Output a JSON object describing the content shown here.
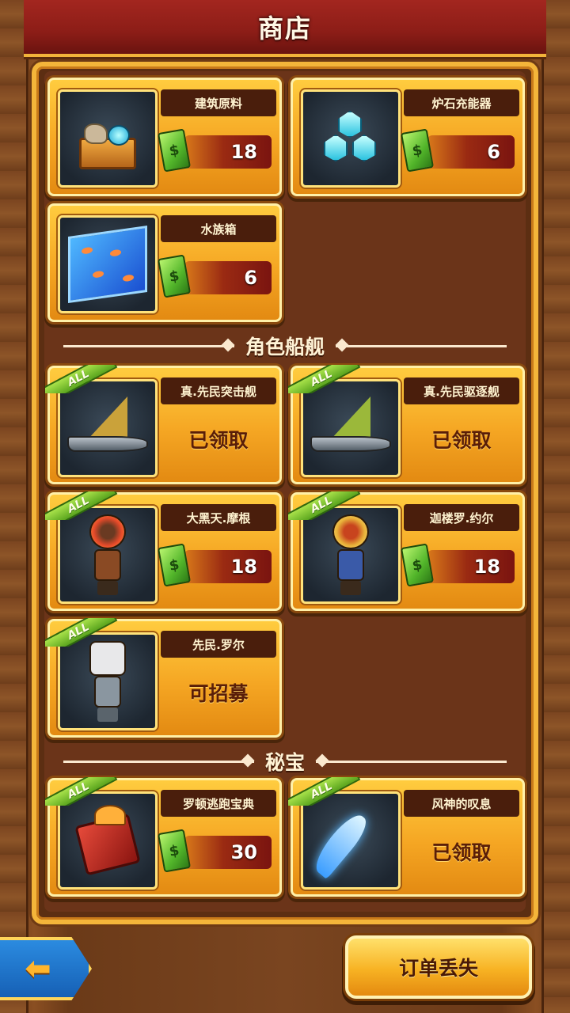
{
  "header": {
    "title": "商店"
  },
  "resources": [
    {
      "name": "建筑原料",
      "price": "18",
      "icon": "crate-of-stones-icon"
    },
    {
      "name": "炉石充能器",
      "price": "6",
      "icon": "blue-crystal-icon"
    },
    {
      "name": "水族箱",
      "price": "6",
      "icon": "aquarium-icon"
    }
  ],
  "ships_section": {
    "title": "角色船舰",
    "ships": [
      {
        "name": "真.先民突击舰",
        "status": "已领取",
        "badge": "ALL",
        "icon": "gold-sail-ship-icon"
      },
      {
        "name": "真.先民驱逐舰",
        "status": "已领取",
        "badge": "ALL",
        "icon": "green-sail-ship-icon"
      }
    ],
    "heroes": [
      {
        "name": "大黑天.摩根",
        "price": "18",
        "badge": "ALL",
        "icon": "fire-hair-warrior-icon"
      },
      {
        "name": "迦楼罗.约尔",
        "price": "18",
        "badge": "ALL",
        "icon": "golden-helmet-warrior-icon"
      },
      {
        "name": "先民.罗尔",
        "status": "可招募",
        "badge": "ALL",
        "icon": "robot-head-hero-icon"
      }
    ]
  },
  "treasure_section": {
    "title": "秘宝",
    "items": [
      {
        "name": "罗顿逃跑宝典",
        "price": "30",
        "badge": "ALL",
        "icon": "winged-book-icon"
      },
      {
        "name": "风神的叹息",
        "status": "已领取",
        "badge": "ALL",
        "icon": "blue-feather-icon"
      }
    ]
  },
  "footer": {
    "back_icon": "left-arrow-icon",
    "order_lost_label": "订单丢失"
  },
  "colors": {
    "title_bar": "#8c1d17",
    "card_gold": "#f5a623",
    "panel_bg": "#6b3419",
    "money_green": "#52b52a"
  }
}
